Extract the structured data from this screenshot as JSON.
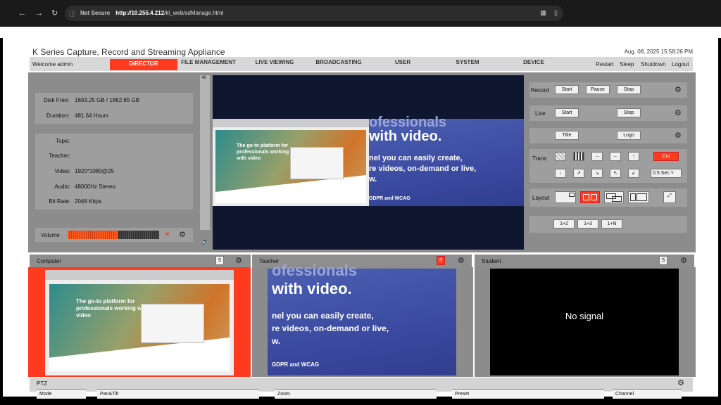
{
  "browser": {
    "not_secure": "Not Secure",
    "url_host": "http://10.255.4.212",
    "url_path": "/kl_web/sdManage.html"
  },
  "app": {
    "title": "K Series Capture, Record and Streaming Appliance",
    "datetime": "Aug. 08, 2025 15:58:26 PM",
    "welcome": "Welcome admin"
  },
  "nav": [
    "DIRECTOR",
    "FILE MANAGEMENT",
    "LIVE VIEWING",
    "BROADCASTING",
    "USER",
    "SYSTEM",
    "DEVICE"
  ],
  "system_actions": [
    "Restart",
    "Sleep",
    "Shutdown",
    "Logout"
  ],
  "status": {
    "disk_label": "Disk Free:",
    "disk_value": "1693.25 GB / 1862.65 GB",
    "duration_label": "Duration:",
    "duration_value": "481.64 Hours"
  },
  "info": {
    "topic_label": "Topic:",
    "teacher_label": "Teacher:",
    "video_label": "Video:",
    "video_value": "1920*1080@25",
    "audio_label": "Audio:",
    "audio_value": "48000Hz Stereo",
    "bitrate_label": "Bit Rate:",
    "bitrate_value": "2048 Kbps"
  },
  "volume": {
    "label": "Volume",
    "level": 0.55,
    "side_value": "48"
  },
  "controls": {
    "record_label": "Record",
    "record_start": "Start",
    "record_pause": "Pause",
    "record_stop": "Stop",
    "live_label": "Live",
    "live_start": "Start",
    "live_stop": "Stop",
    "title_btn": "Title",
    "logo_btn": "Logo",
    "trans_label": "Trans",
    "cut": "Cut",
    "speed": "0.5 Sec",
    "layout_label": "Layout",
    "combos": [
      "1+2",
      "1+3",
      "1+N"
    ]
  },
  "preview": {
    "heading": "The go-to platform for professionals working with video",
    "big1": "ofessionals",
    "big2": "with video.",
    "body1": "nel you can easily create,",
    "body2": "re videos, on-demand or live,",
    "body3": "w.",
    "footer": "GDPR and WCAG"
  },
  "sources": [
    {
      "name": "Computer",
      "s": "S"
    },
    {
      "name": "Teacher",
      "s": "S"
    },
    {
      "name": "Student",
      "s": "S",
      "nosignal": "No signal"
    }
  ],
  "ptz": {
    "label": "PTZ",
    "sections": [
      "Mode",
      "Pan&Tilt",
      "Zoom",
      "Preset",
      "Channel"
    ]
  },
  "colors": {
    "accent": "#ff3b1f",
    "panel": "#8c8c8c"
  }
}
